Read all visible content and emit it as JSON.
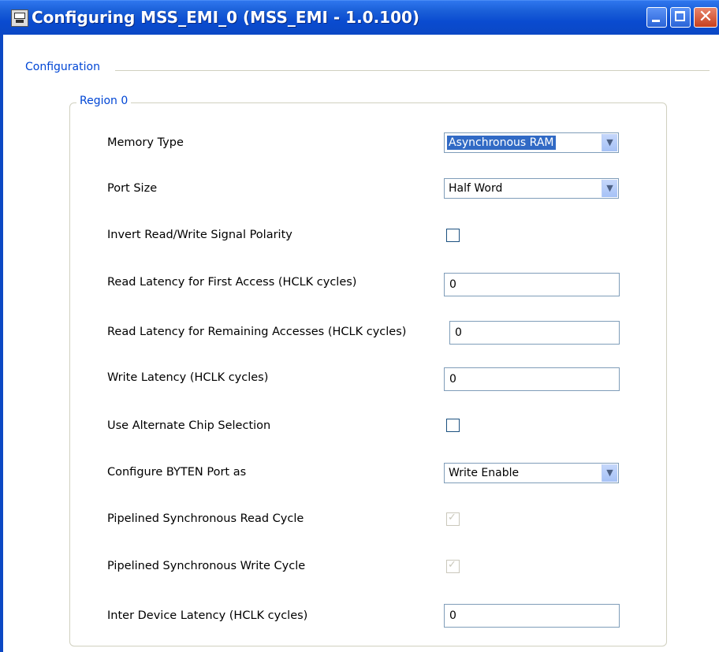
{
  "window": {
    "title": "Configuring MSS_EMI_0 (MSS_EMI - 1.0.100)",
    "close_glyph": "✕"
  },
  "configuration": {
    "label": "Configuration",
    "region": {
      "label": "Region 0",
      "fields": [
        {
          "label": "Memory Type",
          "control": "select",
          "value": "Asynchronous RAM",
          "focused": true
        },
        {
          "label": "Port Size",
          "control": "select",
          "value": "Half Word"
        },
        {
          "label": "Invert Read/Write Signal Polarity",
          "control": "checkbox",
          "checked": false
        },
        {
          "label": "Read Latency for First Access (HCLK cycles)",
          "control": "text",
          "value": "0"
        },
        {
          "label": "Read Latency for Remaining Accesses (HCLK cycles)",
          "control": "text",
          "value": "0"
        },
        {
          "label": "Write Latency (HCLK cycles)",
          "control": "text",
          "value": "0"
        },
        {
          "label": "Use Alternate Chip Selection",
          "control": "checkbox",
          "checked": false
        },
        {
          "label": "Configure BYTEN Port as",
          "control": "select",
          "value": "Write Enable"
        },
        {
          "label": "Pipelined Synchronous Read Cycle",
          "control": "checkbox",
          "checked": true,
          "disabled": true
        },
        {
          "label": "Pipelined Synchronous Write Cycle",
          "control": "checkbox",
          "checked": true,
          "disabled": true
        },
        {
          "label": "Inter Device Latency (HCLK cycles)",
          "control": "text",
          "value": "0"
        }
      ]
    }
  },
  "icons": {
    "dropdown_arrow": "chevron-down-icon",
    "check": "checkmark-icon",
    "check_glyph": "✓",
    "arrow_glyph": "▼"
  },
  "colors": {
    "titlebar": "#0b48c4",
    "group_label": "#0046d5",
    "selection": "#316ac5",
    "background": "#ffffff"
  }
}
